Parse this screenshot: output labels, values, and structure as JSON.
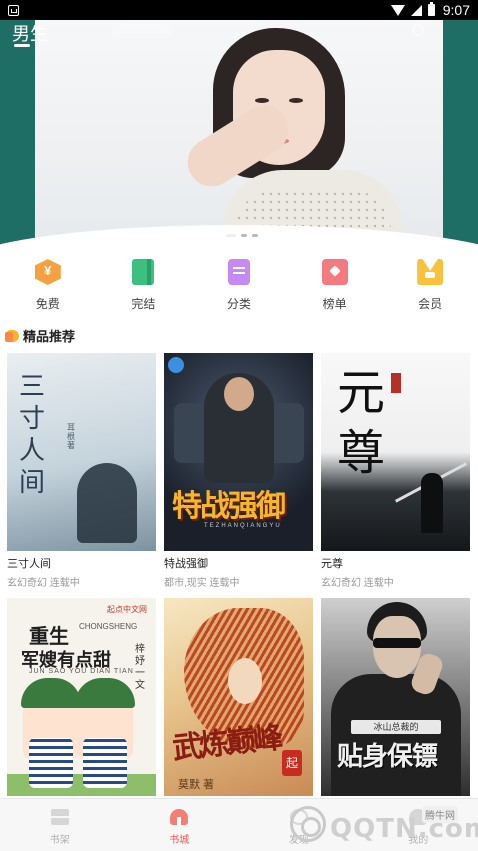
{
  "status_bar": {
    "time": "9:07"
  },
  "banner": {
    "active_tab": "男生",
    "slide_count": 3,
    "active_slide": 1
  },
  "categories": [
    {
      "label": "免费",
      "icon": "free-coin-icon"
    },
    {
      "label": "完结",
      "icon": "finished-book-icon"
    },
    {
      "label": "分类",
      "icon": "category-icon"
    },
    {
      "label": "榜单",
      "icon": "ranking-icon"
    },
    {
      "label": "会员",
      "icon": "vip-crown-icon"
    }
  ],
  "section": {
    "title": "精品推荐"
  },
  "books": [
    {
      "title": "三寸人间",
      "meta": "玄幻奇幻 连载中",
      "cover_text": "三寸人间",
      "cover_author": "耳根 著"
    },
    {
      "title": "特战强御",
      "meta": "都市,现实 连载中",
      "cover_text": "特战强御",
      "cover_sub": "TEZHANQIANGYU"
    },
    {
      "title": "元尊",
      "meta": "玄幻奇幻 连载中",
      "cover_text": "元尊"
    },
    {
      "title": "",
      "meta": "",
      "cover_logo": "起点中文网",
      "cover_line1": "重生",
      "cover_line1b": "CHONGSHENG",
      "cover_line2": "军嫂有点甜",
      "cover_pinyin": "JUN SAO YOU DIAN TIAN",
      "cover_side": "梓妤一文"
    },
    {
      "title": "",
      "meta": "",
      "cover_text": "武炼巅峰",
      "cover_stamp": "起",
      "cover_author": "莫默 著"
    },
    {
      "title": "",
      "meta": "",
      "cover_sub": "冰山总裁的",
      "cover_text": "贴身保镖"
    }
  ],
  "bottom_nav": [
    {
      "label": "书架",
      "icon": "bookshelf-icon",
      "active": false
    },
    {
      "label": "书城",
      "icon": "bookstore-icon",
      "active": true
    },
    {
      "label": "发现",
      "icon": "discover-icon",
      "active": false
    },
    {
      "label": "我的",
      "icon": "profile-icon",
      "active": false
    }
  ],
  "watermark": {
    "text": "QQTN.com",
    "badge": "腾牛网"
  },
  "colors": {
    "accent": "#ef5a52",
    "banner_bg": "#1e6e66"
  }
}
